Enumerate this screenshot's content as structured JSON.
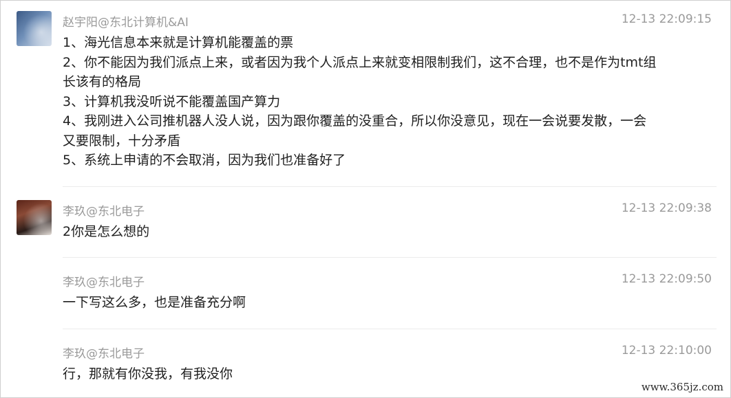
{
  "messages": [
    {
      "sender": "赵宇阳@东北计算机&AI",
      "time": "12-13 22:09:15",
      "avatar": "avatar-icon",
      "lines": [
        "1、海光信息本来就是计算机能覆盖的票",
        "2、你不能因为我们派点上来，或者因为我个人派点上来就变相限制我们，这不合理，也不是作为tmt组",
        "长该有的格局",
        "3、计算机我没听说不能覆盖国产算力",
        "4、我刚进入公司推机器人没人说，因为跟你覆盖的没重合，所以你没意见，现在一会说要发散，一会",
        "又要限制，十分矛盾",
        "5、系统上申请的不会取消，因为我们也准备好了"
      ]
    },
    {
      "sender": "李玖@东北电子",
      "time": "12-13 22:09:38",
      "avatar": "avatar-icon",
      "lines": [
        "2你是怎么想的"
      ]
    },
    {
      "sender": "李玖@东北电子",
      "time": "12-13 22:09:50",
      "lines": [
        "一下写这么多，也是准备充分啊"
      ]
    },
    {
      "sender": "李玖@东北电子",
      "time": "12-13 22:10:00",
      "lines": [
        "行，那就有你没我，有我没你"
      ]
    }
  ],
  "watermark": "www.365jz.com",
  "colors": {
    "meta_text": "#9a9a9a",
    "body_text": "#1f1f1f",
    "divider": "#ececec"
  }
}
